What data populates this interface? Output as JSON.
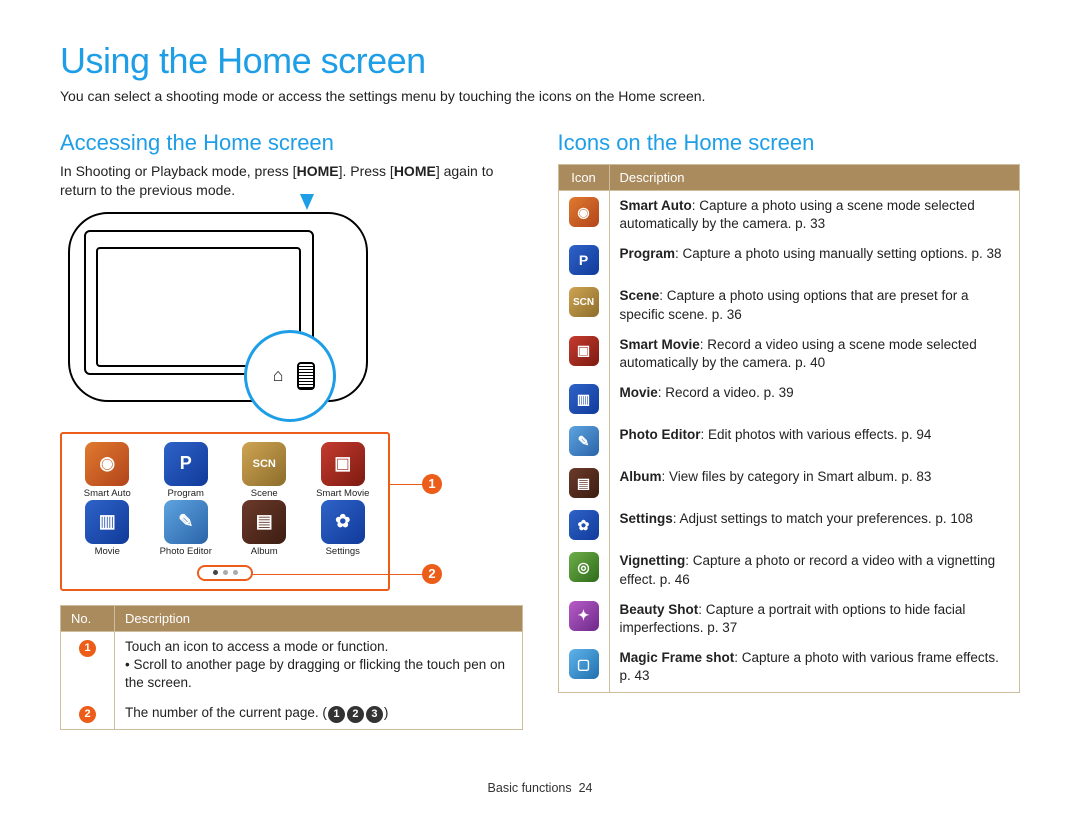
{
  "page": {
    "title": "Using the Home screen",
    "intro": "You can select a shooting mode or access the settings menu by touching the icons on the Home screen.",
    "footer_label": "Basic functions",
    "footer_page": "24"
  },
  "left": {
    "heading": "Accessing the Home screen",
    "para_pre": "In Shooting or Playback mode, press [",
    "key1": "HOME",
    "para_mid": "]. Press [",
    "key2": "HOME",
    "para_post": "] again to return to the previous mode.",
    "grid": [
      {
        "label": "Smart Auto",
        "glyph": "◉",
        "bg": "linear-gradient(135deg,#e07a2f,#b2441b)"
      },
      {
        "label": "Program",
        "glyph": "P",
        "bg": "linear-gradient(135deg,#2f63c8,#103a9a)"
      },
      {
        "label": "Scene",
        "glyph": "SCN",
        "bg": "linear-gradient(135deg,#cfa452,#8c6d2c)"
      },
      {
        "label": "Smart Movie",
        "glyph": "▣",
        "bg": "linear-gradient(135deg,#c53b2f,#7d1a11)"
      },
      {
        "label": "Movie",
        "glyph": "▥",
        "bg": "linear-gradient(135deg,#2f63c8,#103a9a)"
      },
      {
        "label": "Photo Editor",
        "glyph": "✎",
        "bg": "linear-gradient(135deg,#5ea4e0,#2a63a8)"
      },
      {
        "label": "Album",
        "glyph": "▤",
        "bg": "linear-gradient(135deg,#6b3a2a,#3d1d12)"
      },
      {
        "label": "Settings",
        "glyph": "✿",
        "bg": "linear-gradient(135deg,#2f63c8,#103a9a)"
      }
    ],
    "table_headers": {
      "no": "No.",
      "desc": "Description"
    },
    "rows": [
      {
        "num": "1",
        "lines": [
          "Touch an icon to access a mode or function.",
          "• Scroll to another page by dragging or flicking the touch pen on the screen."
        ]
      },
      {
        "num": "2",
        "lines": [
          "The number of the current page. ("
        ],
        "trailing_badges": [
          "1",
          "2",
          "3"
        ],
        "close": ")"
      }
    ]
  },
  "right": {
    "heading": "Icons on the Home screen",
    "header_icon": "Icon",
    "header_desc": "Description",
    "rows": [
      {
        "icon_glyph": "◉",
        "icon_bg": "linear-gradient(135deg,#e07a2f,#b2441b)",
        "term": "Smart Auto",
        "text": ": Capture a photo using a scene mode selected automatically by the camera. p. 33"
      },
      {
        "icon_glyph": "P",
        "icon_bg": "linear-gradient(135deg,#2f63c8,#103a9a)",
        "term": "Program",
        "text": ": Capture a photo using manually setting options. p. 38"
      },
      {
        "icon_glyph": "SCN",
        "icon_bg": "linear-gradient(135deg,#cfa452,#8c6d2c)",
        "term": "Scene",
        "text": ": Capture a photo using options that are preset for a specific scene. p. 36"
      },
      {
        "icon_glyph": "▣",
        "icon_bg": "linear-gradient(135deg,#c53b2f,#7d1a11)",
        "term": "Smart Movie",
        "text": ": Record a video using a scene mode selected automatically by the camera. p. 40"
      },
      {
        "icon_glyph": "▥",
        "icon_bg": "linear-gradient(135deg,#2f63c8,#103a9a)",
        "term": "Movie",
        "text": ": Record a video. p. 39"
      },
      {
        "icon_glyph": "✎",
        "icon_bg": "linear-gradient(135deg,#5ea4e0,#2a63a8)",
        "term": "Photo Editor",
        "text": ": Edit photos with various effects. p. 94"
      },
      {
        "icon_glyph": "▤",
        "icon_bg": "linear-gradient(135deg,#6b3a2a,#3d1d12)",
        "term": "Album",
        "text": ": View files by category in Smart album. p. 83"
      },
      {
        "icon_glyph": "✿",
        "icon_bg": "linear-gradient(135deg,#2f63c8,#103a9a)",
        "term": "Settings",
        "text": ": Adjust settings to match your preferences. p. 108"
      },
      {
        "icon_glyph": "◎",
        "icon_bg": "linear-gradient(135deg,#6fae4a,#2e6b19)",
        "term": "Vignetting",
        "text": ": Capture a photo or record a video with a vignetting effect. p. 46"
      },
      {
        "icon_glyph": "✦",
        "icon_bg": "linear-gradient(135deg,#b85bc7,#6c2a8a)",
        "term": "Beauty Shot",
        "text": ": Capture a portrait with options to hide facial imperfections. p. 37"
      },
      {
        "icon_glyph": "▢",
        "icon_bg": "linear-gradient(135deg,#5fb4ea,#1f6fae)",
        "term": "Magic Frame shot",
        "text": ": Capture a photo with various frame effects. p. 43"
      }
    ]
  }
}
